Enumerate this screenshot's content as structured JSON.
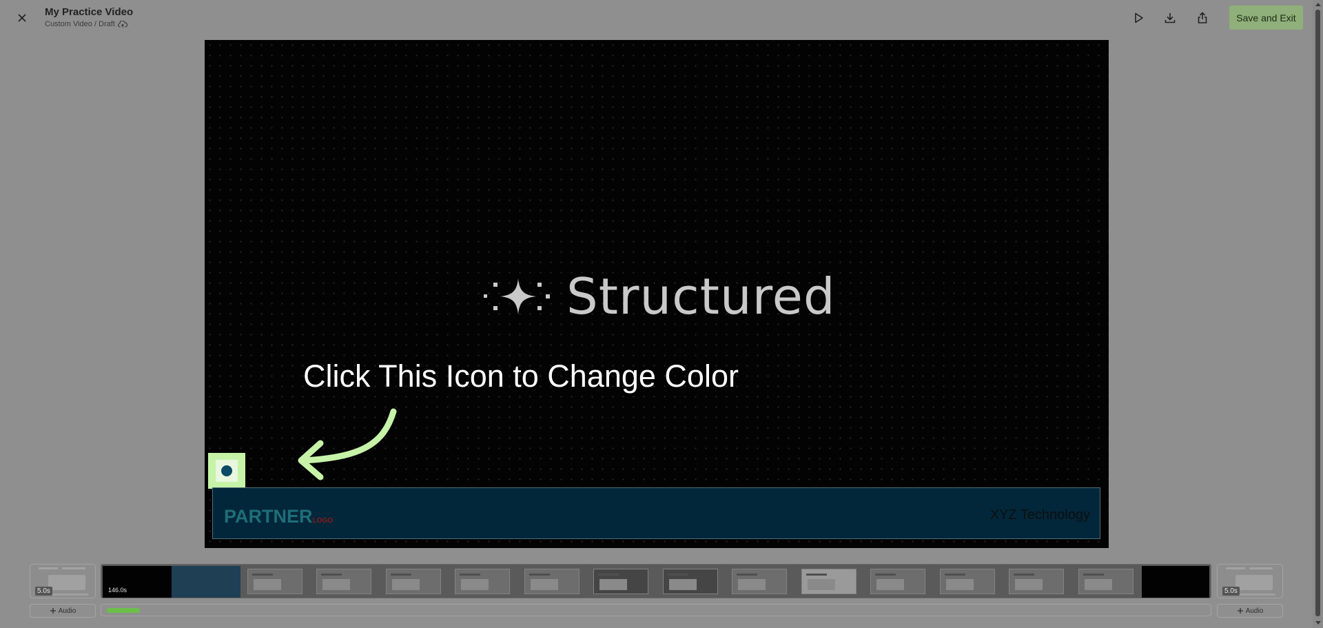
{
  "header": {
    "title": "My Practice Video",
    "subtitle": "Custom Video / Draft",
    "save_label": "Save and Exit"
  },
  "canvas": {
    "brand_text": "Structured",
    "headline": "Click This Icon to Change Color",
    "banner": {
      "logo_text": "PARTNER",
      "logo_sub": "LOGO",
      "company": "XYZ Technology",
      "background_color": "#03273a"
    },
    "color_swatch": "#0c4a66"
  },
  "timeline": {
    "left_duration": "5.0s",
    "right_duration": "5.0s",
    "main_duration": "146.0s",
    "add_audio_label": "Audio",
    "progress": 0.03
  },
  "colors": {
    "accent": "#8fb07a",
    "highlight": "#c6f3a8",
    "progress": "#6cbf4a"
  }
}
